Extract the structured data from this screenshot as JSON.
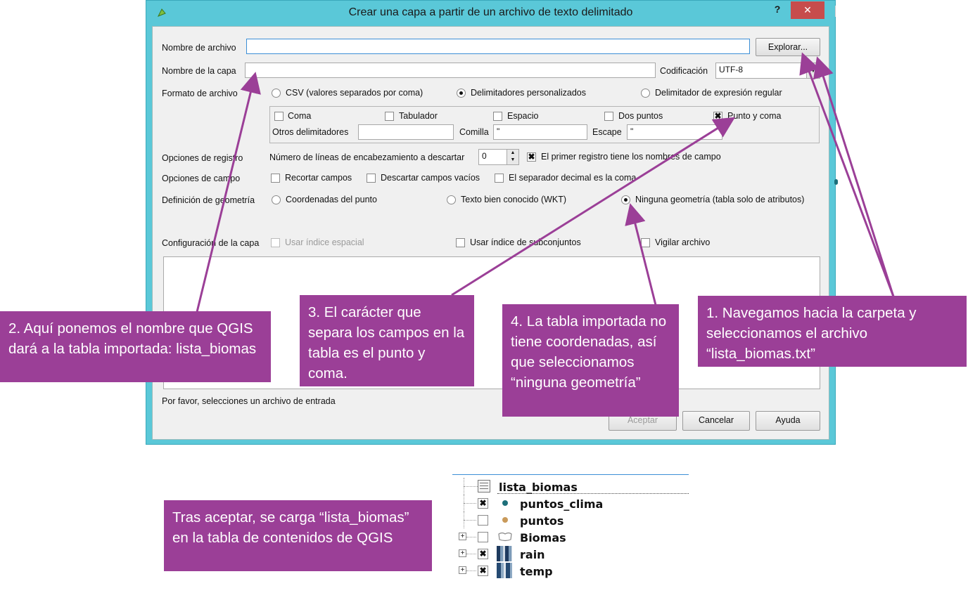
{
  "dialog": {
    "title": "Crear una capa a partir de un archivo de texto delimitado",
    "help_symbol": "?",
    "close_symbol": "✕",
    "file_name_label": "Nombre de archivo",
    "file_name_value": "",
    "browse_label": "Explorar...",
    "layer_name_label": "Nombre de la capa",
    "layer_name_value": "",
    "encoding_label": "Codificación",
    "encoding_value": "UTF-8",
    "format_label": "Formato de archivo",
    "format_options": [
      "CSV (valores separados por coma)",
      "Delimitadores personalizados",
      "Delimitador de expresión regular"
    ],
    "format_selected": "Delimitadores personalizados",
    "delimiters": [
      {
        "label": "Coma",
        "checked": false
      },
      {
        "label": "Tabulador",
        "checked": false
      },
      {
        "label": "Espacio",
        "checked": false
      },
      {
        "label": "Dos puntos",
        "checked": false
      },
      {
        "label": "Punto y coma",
        "checked": true
      }
    ],
    "other_delimiters_label": "Otros delimitadores",
    "other_delimiters_value": "",
    "quote_label": "Comilla",
    "quote_value": "\"",
    "escape_label": "Escape",
    "escape_value": "\"",
    "record_options_label": "Opciones de registro",
    "header_lines_label": "Número de líneas de encabezamiento a descartar",
    "header_lines_value": "0",
    "first_record_label": "El primer registro tiene los nombres de campo",
    "first_record_checked": true,
    "field_options_label": "Opciones de campo",
    "field_options": [
      "Recortar campos",
      "Descartar campos vacíos",
      "El separador decimal es la coma"
    ],
    "geometry_label": "Definición de geometría",
    "geometry_options": [
      "Coordenadas del punto",
      "Texto bien conocido (WKT)",
      "Ninguna geometría (tabla solo de atributos)"
    ],
    "geometry_selected": "Ninguna geometría (tabla solo de atributos)",
    "layer_config_label": "Configuración de la capa",
    "layer_config_options": [
      "Usar índice espacial",
      "Usar índice de subconjuntos",
      "Vigilar archivo"
    ],
    "status_text": "Por favor, selecciones un archivo de entrada",
    "accept_label": "Aceptar",
    "cancel_label": "Cancelar",
    "help_label": "Ayuda"
  },
  "callouts": {
    "c1": "1. Navegamos hacia la carpeta y seleccionamos el archivo “lista_biomas.txt”",
    "c2": "2. Aquí ponemos el nombre que QGIS dará a la tabla importada: lista_biomas",
    "c3": "3. El carácter que separa los campos en la tabla es el punto y coma.",
    "c4": "4. La tabla importada no tiene coordenadas, así que seleccionamos “ninguna geometría”",
    "c5": "Tras aceptar, se carga “lista_biomas” en la tabla de contenidos de QGIS"
  },
  "legend": {
    "layers": [
      {
        "name": "lista_biomas",
        "checked": null,
        "icon": "table-icon"
      },
      {
        "name": "puntos_clima",
        "checked": true,
        "icon": "point-icon"
      },
      {
        "name": "puntos",
        "checked": false,
        "icon": "point-icon"
      },
      {
        "name": "Biomas",
        "checked": false,
        "icon": "polygon-icon"
      },
      {
        "name": "rain",
        "checked": true,
        "icon": "raster-icon"
      },
      {
        "name": "temp",
        "checked": true,
        "icon": "raster-icon"
      }
    ]
  },
  "colors": {
    "callout_bg": "#9b3f97",
    "arrow": "#9b3f97",
    "title_bar": "#5ac8d8",
    "close_button": "#c74c4c"
  }
}
